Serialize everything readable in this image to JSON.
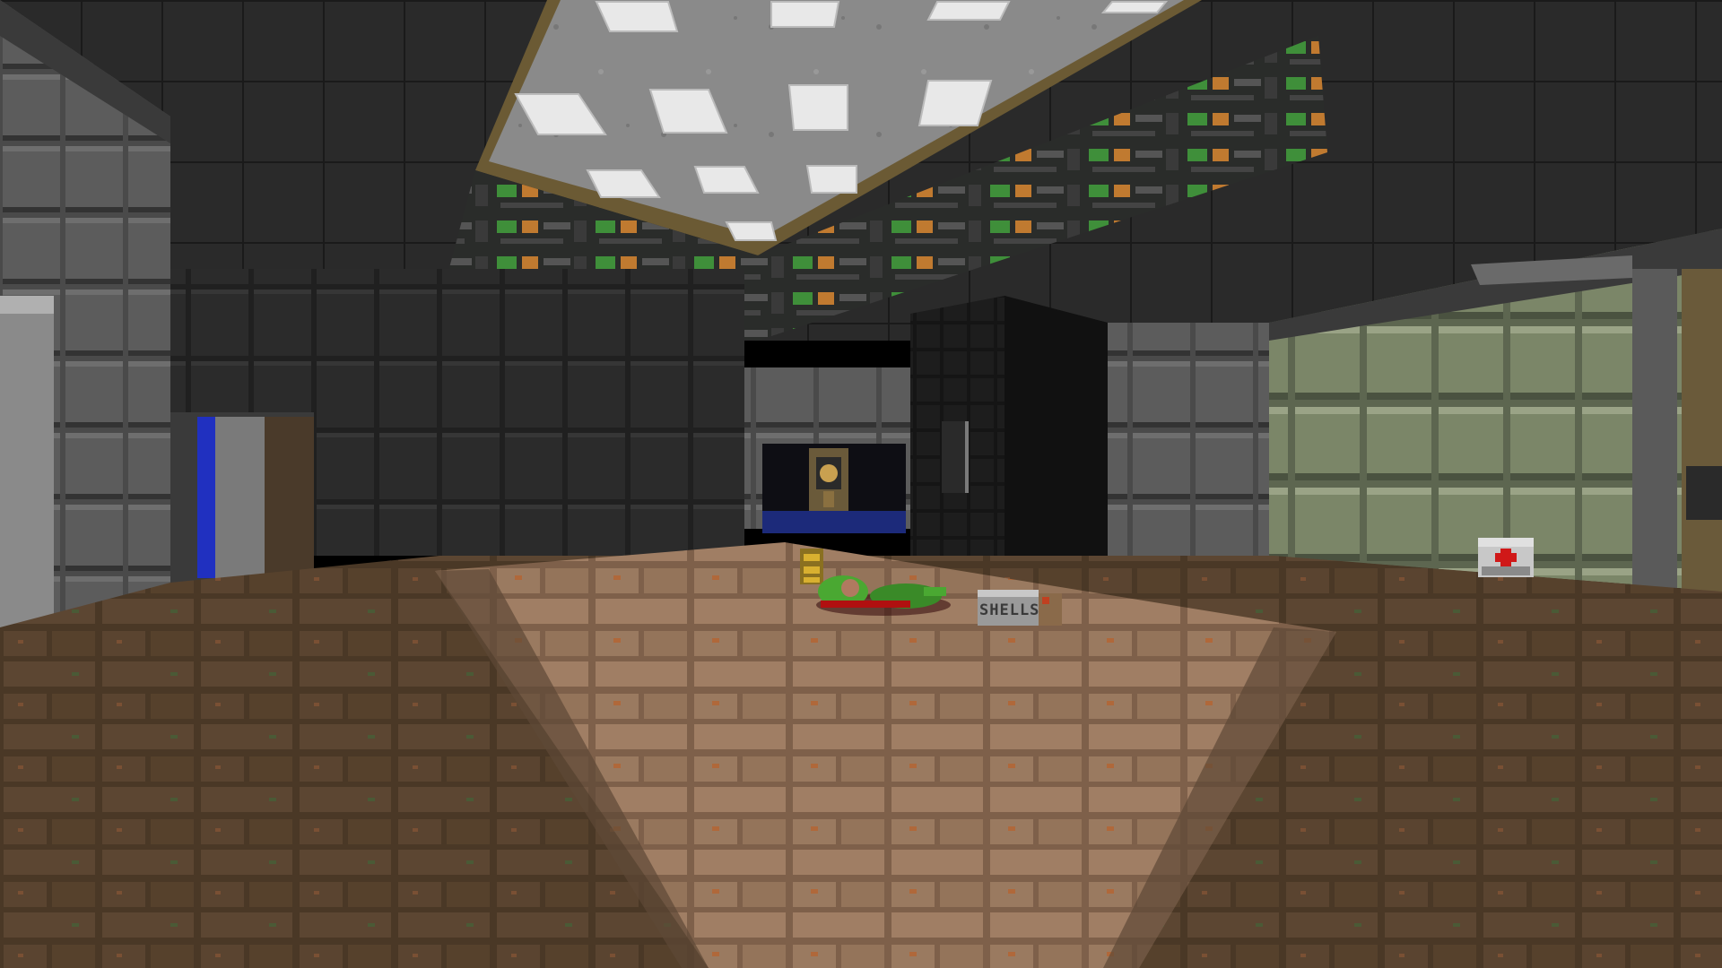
{
  "game": {
    "title": "",
    "view": "first-person"
  },
  "scene": {
    "pickups": {
      "shells_box": {
        "label": "SHELLS",
        "icon": "shotgun-shells-box-icon"
      },
      "medikit": {
        "icon": "medikit-red-cross-icon"
      },
      "armor_bonus": {
        "icon": "armor-bonus-icon"
      },
      "ammo_clip": {
        "icon": "bullet-clip-icon"
      }
    },
    "props": {
      "corpse": {
        "icon": "dead-marine-icon"
      },
      "wall_decoration": {
        "icon": "skull-emblem-icon"
      }
    },
    "colors": {
      "ceiling_light_panel": "#d9d9d9",
      "floor_brown": "#6b4e34",
      "floor_lit": "#a07a5c",
      "wall_grey": "#5a5a5a",
      "wall_green": "#6d7a58",
      "computer_green": "#3f8f3a",
      "corpse_green": "#4aa832",
      "blood_red": "#b01010",
      "medikit_cross": "#d01818",
      "key_blue": "#2030c0"
    }
  }
}
